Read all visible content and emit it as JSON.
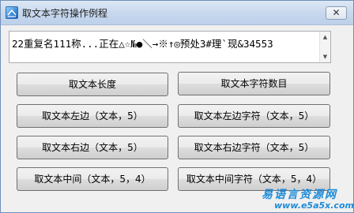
{
  "window": {
    "title": "取文本字符操作例程",
    "close_label": "✕",
    "icon": "app-icon"
  },
  "textbox": {
    "value": "22重复名111称...正在△☆№●＼→※↑◎预处3#理`现&34553"
  },
  "buttons": [
    {
      "label": "取文本长度"
    },
    {
      "label": "取文本字符数目"
    },
    {
      "label": "取文本左边（文本，5）"
    },
    {
      "label": "取文本左边字符（文本，5）"
    },
    {
      "label": "取文本右边（文本，5）"
    },
    {
      "label": "取文本右边字符（文本，5）"
    },
    {
      "label": "取文本中间（文本，5，4）"
    },
    {
      "label": "取文本中间字符（文本，5，4）"
    }
  ],
  "watermark": {
    "cn": "易语言资源网",
    "en": "www.e5a5x.com"
  },
  "colors": {
    "titlebar": "#c8d9ee",
    "window_bg": "#f0f0f0",
    "watermark": "#1d8bd8"
  }
}
